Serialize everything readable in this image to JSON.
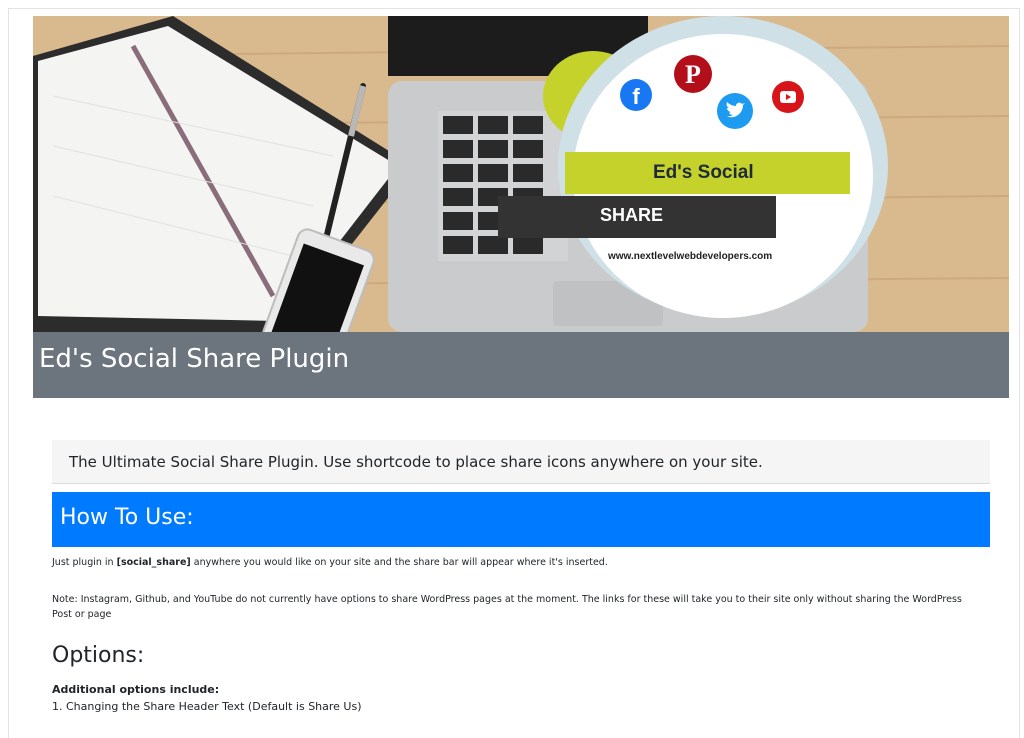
{
  "hero": {
    "logo_line1": "Ed's Social",
    "logo_line2": "SHARE",
    "logo_url": "www.nextlevelwebdevelopers.com",
    "title": "Ed's Social Share Plugin",
    "icons": [
      "facebook-icon",
      "pinterest-icon",
      "twitter-icon",
      "youtube-icon"
    ]
  },
  "tagline": "The Ultimate Social Share Plugin. Use shortcode to place share icons anywhere on your site.",
  "how_to": {
    "heading": "How To Use:",
    "p1_prefix": "Just plugin in ",
    "p1_code": "[social_share]",
    "p1_suffix": " anywhere you would like on your site and the share bar will appear where it's inserted.",
    "note": "Note: Instagram, Github, and YouTube do not currently have options to share WordPress pages at the moment. The links for these will take you to their site only without sharing the WordPress Post or page"
  },
  "options": {
    "heading": "Options:",
    "intro": "Additional options include:",
    "items": [
      "1. Changing the Share Header Text (Default is Share Us)"
    ]
  },
  "colors": {
    "title_bar": "#6c757d",
    "how_to_bar": "#007bff",
    "logo_green": "#c5d22c",
    "logo_dark": "#333333"
  }
}
